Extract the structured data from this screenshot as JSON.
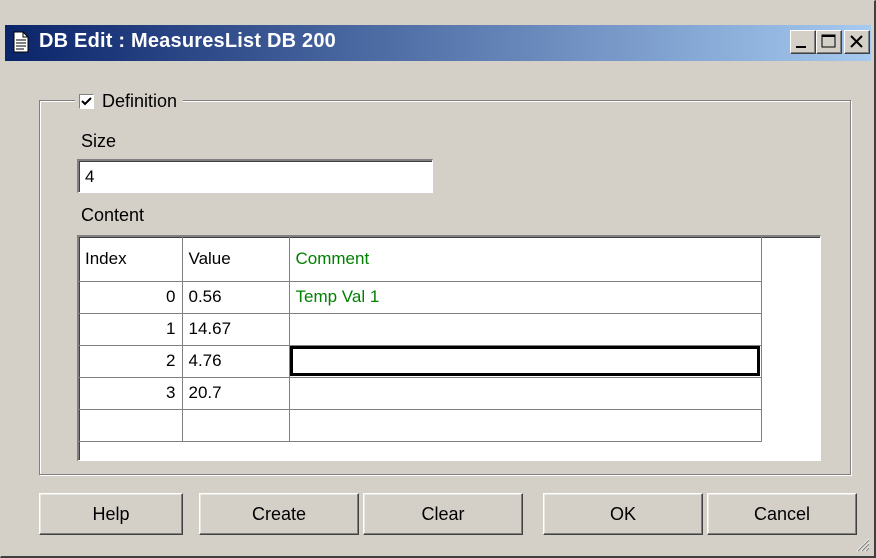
{
  "window": {
    "title": "DB Edit : MeasuresList DB 200",
    "buttons": {
      "minimize": "minimize-icon",
      "maximize": "maximize-icon",
      "close": "close-icon"
    }
  },
  "definition": {
    "label": "Definition",
    "checked": true
  },
  "size": {
    "label": "Size",
    "value": "4"
  },
  "content": {
    "label": "Content",
    "columns": [
      "Index",
      "Value",
      "Comment"
    ],
    "rows": [
      {
        "index": "0",
        "value": "0.56",
        "comment": "Temp Val 1"
      },
      {
        "index": "1",
        "value": "14.67",
        "comment": ""
      },
      {
        "index": "2",
        "value": "4.76",
        "comment": ""
      },
      {
        "index": "3",
        "value": "20.7",
        "comment": ""
      },
      {
        "index": "",
        "value": "",
        "comment": ""
      }
    ]
  },
  "actions": {
    "help": "Help",
    "create": "Create",
    "clear": "Clear",
    "ok": "OK",
    "cancel": "Cancel"
  },
  "colors": {
    "titlebar_start": "#0a246a",
    "titlebar_end": "#a6caf0",
    "comment_text": "#008000",
    "face": "#d4d0c8"
  }
}
